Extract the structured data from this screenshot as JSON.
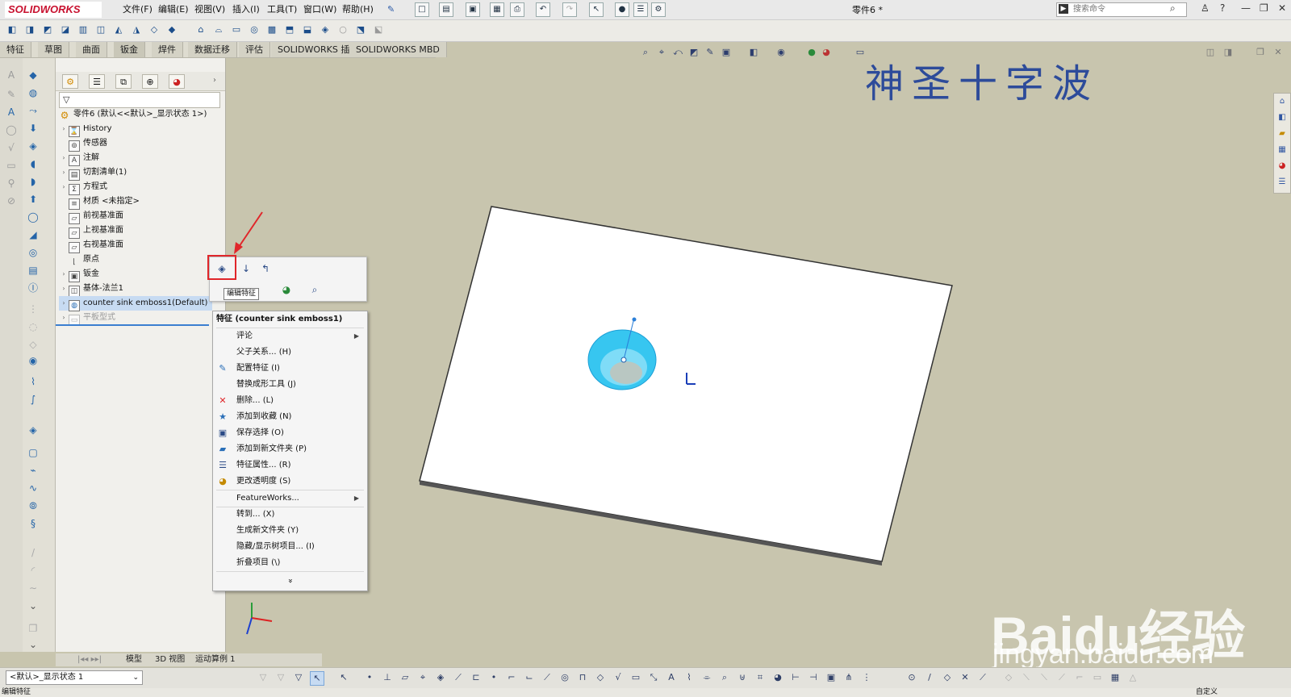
{
  "app": {
    "logo_text": "SOLIDWORKS",
    "document_title": "零件6 *",
    "menu": [
      "文件(F)",
      "编辑(E)",
      "视图(V)",
      "插入(I)",
      "工具(T)",
      "窗口(W)",
      "帮助(H)"
    ],
    "search_placeholder": "搜索命令",
    "window_controls": [
      "?",
      "—",
      "❐",
      "✕"
    ]
  },
  "command_tabs": [
    "特征",
    "草图",
    "曲面",
    "钣金",
    "焊件",
    "数据迁移",
    "评估",
    "SOLIDWORKS 插件",
    "SOLIDWORKS MBD"
  ],
  "feature_tree": {
    "root": "零件6  (默认<<默认>_显示状态 1>)",
    "items": [
      {
        "label": "History",
        "icon": "history-icon",
        "expandable": true
      },
      {
        "label": "传感器",
        "icon": "sensor-icon",
        "expandable": false
      },
      {
        "label": "注解",
        "icon": "annotation-icon",
        "expandable": true
      },
      {
        "label": "切割清单(1)",
        "icon": "cutlist-icon",
        "expandable": true
      },
      {
        "label": "方程式",
        "icon": "equation-icon",
        "expandable": true
      },
      {
        "label": "材质 <未指定>",
        "icon": "material-icon",
        "expandable": false
      },
      {
        "label": "前视基准面",
        "icon": "plane-icon",
        "expandable": false
      },
      {
        "label": "上视基准面",
        "icon": "plane-icon",
        "expandable": false
      },
      {
        "label": "右视基准面",
        "icon": "plane-icon",
        "expandable": false
      },
      {
        "label": "原点",
        "icon": "origin-icon",
        "expandable": false
      },
      {
        "label": "钣金",
        "icon": "sheetmetal-icon",
        "expandable": true
      },
      {
        "label": "基体-法兰1",
        "icon": "flange-icon",
        "expandable": true
      },
      {
        "label": "counter sink emboss1(Default)",
        "icon": "forming-tool-icon",
        "expandable": true,
        "selected": true
      },
      {
        "label": "平板型式",
        "icon": "flat-pattern-icon",
        "expandable": true,
        "dim": true
      }
    ]
  },
  "context_toolbar": {
    "tooltip": "编辑特征"
  },
  "context_menu": {
    "header": "特征 (counter sink emboss1)",
    "items": [
      {
        "label": "评论",
        "icon": "",
        "submenu": true
      },
      {
        "label": "父子关系... (H)",
        "icon": "",
        "submenu": false
      },
      {
        "label": "配置特征 (I)",
        "icon": "configure-icon",
        "submenu": false
      },
      {
        "label": "替换成形工具 (J)",
        "icon": "",
        "submenu": false
      },
      {
        "label": "删除... (L)",
        "icon": "delete-icon",
        "submenu": false
      },
      {
        "label": "添加到收藏 (N)",
        "icon": "favorite-icon",
        "submenu": false
      },
      {
        "label": "保存选择 (O)",
        "icon": "save-selection-icon",
        "submenu": false
      },
      {
        "label": "添加到新文件夹 (P)",
        "icon": "folder-icon",
        "submenu": false
      },
      {
        "label": "特征属性... (R)",
        "icon": "properties-icon",
        "submenu": false
      },
      {
        "label": "更改透明度 (S)",
        "icon": "transparency-icon",
        "submenu": false
      },
      {
        "label": "FeatureWorks...",
        "icon": "",
        "submenu": true
      },
      {
        "label": "转到... (X)",
        "icon": "",
        "submenu": false
      },
      {
        "label": "生成新文件夹 (Y)",
        "icon": "",
        "submenu": false
      },
      {
        "label": "隐藏/显示树项目... (I)",
        "icon": "",
        "submenu": false
      },
      {
        "label": "折叠项目 (\\)",
        "icon": "",
        "submenu": false
      }
    ],
    "expand_glyph": "»"
  },
  "graphics": {
    "overlay_title": "神圣十字波",
    "watermark_logo": "Baidu经验",
    "watermark_url": "jingyan.baidu.com"
  },
  "model_tabs": [
    "模型",
    "3D 视图",
    "运动算例 1"
  ],
  "config_display": "<默认>_显示状态 1",
  "status": {
    "left": "编辑特征",
    "right": "自定义"
  },
  "colors": {
    "viewport_bg": "#c8c5ae",
    "accent_red": "#e0262a",
    "watermark_blue": "#2d4b9a",
    "emboss_cyan": "#37c6f0"
  }
}
